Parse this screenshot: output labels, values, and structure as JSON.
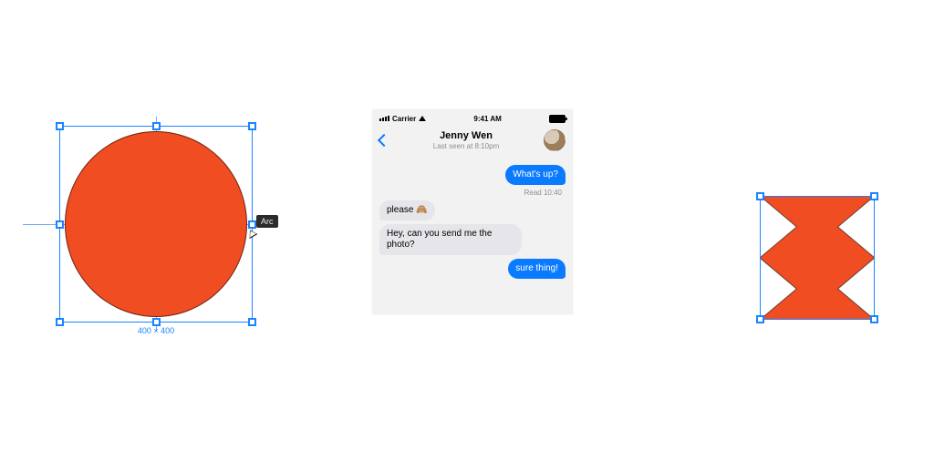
{
  "canvas": {
    "left_shape": {
      "fill": "#f04d22",
      "dimension_label": "400 × 400",
      "arc_tooltip": "Arc"
    },
    "right_shape": {
      "fill": "#f04d22"
    }
  },
  "chat": {
    "status": {
      "carrier": "Carrier",
      "time": "9:41 AM"
    },
    "header": {
      "name": "Jenny Wen",
      "subtitle": "Last seen at 8:10pm"
    },
    "messages": {
      "m0": "What's up?",
      "read0": "Read 10:40",
      "m1_text": "please",
      "m1_emoji": "🙈",
      "m2": "Hey, can you send me the photo?",
      "m3": "sure thing!"
    }
  }
}
